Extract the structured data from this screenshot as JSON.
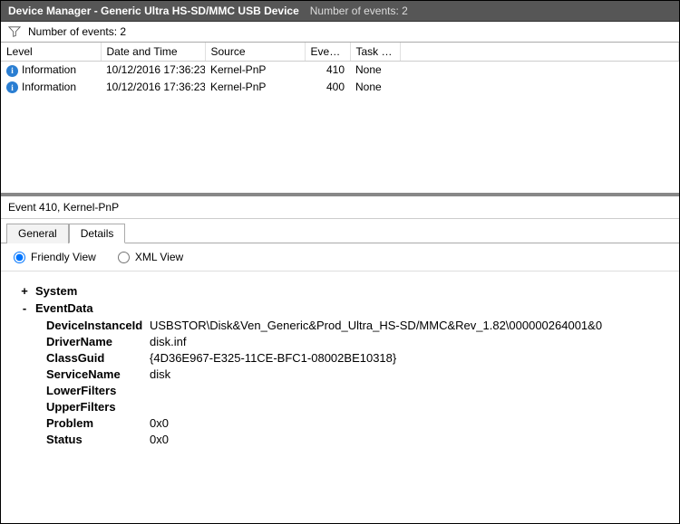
{
  "titlebar": {
    "title": "Device Manager - Generic Ultra HS-SD/MMC USB Device",
    "subtitle": "Number of events: 2"
  },
  "filter": {
    "text": "Number of events: 2"
  },
  "columns": {
    "level": "Level",
    "date": "Date and Time",
    "source": "Source",
    "eventid": "Event ID",
    "task": "Task C..."
  },
  "rows": [
    {
      "level": "Information",
      "date": "10/12/2016 17:36:23",
      "source": "Kernel-PnP",
      "eventid": "410",
      "task": "None"
    },
    {
      "level": "Information",
      "date": "10/12/2016 17:36:23",
      "source": "Kernel-PnP",
      "eventid": "400",
      "task": "None"
    }
  ],
  "detail": {
    "header": "Event 410, Kernel-PnP",
    "tabs": {
      "general": "General",
      "details": "Details"
    },
    "viewmode": {
      "friendly": "Friendly View",
      "xml": "XML View"
    },
    "system_label": "System",
    "eventdata_label": "EventData",
    "fields": {
      "DeviceInstanceId": "USBSTOR\\Disk&Ven_Generic&Prod_Ultra_HS-SD/MMC&Rev_1.82\\000000264001&0",
      "DriverName": "disk.inf",
      "ClassGuid": "{4D36E967-E325-11CE-BFC1-08002BE10318}",
      "ServiceName": "disk",
      "LowerFilters": "",
      "UpperFilters": "",
      "Problem": "0x0",
      "Status": "0x0"
    },
    "keys": {
      "DeviceInstanceId": "DeviceInstanceId",
      "DriverName": "DriverName",
      "ClassGuid": "ClassGuid",
      "ServiceName": "ServiceName",
      "LowerFilters": "LowerFilters",
      "UpperFilters": "UpperFilters",
      "Problem": "Problem",
      "Status": "Status"
    }
  }
}
